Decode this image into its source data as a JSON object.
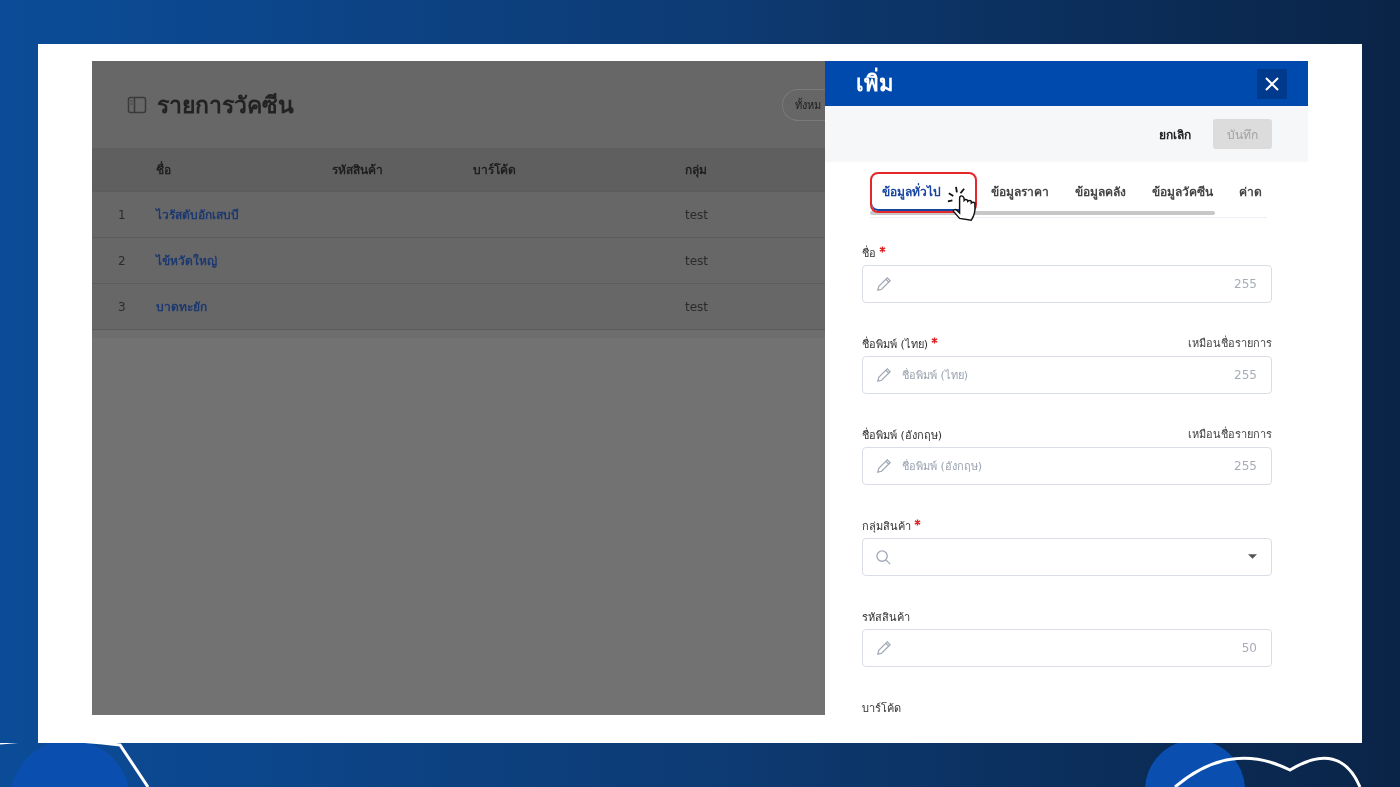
{
  "list_page": {
    "title": "รายการวัคซีน",
    "filter_button": "ทั้งหม"
  },
  "table": {
    "columns": [
      "ชื่อ",
      "รหัสสินค้า",
      "บาร์โค้ด",
      "กลุ่ม"
    ],
    "rows": [
      {
        "number": "1",
        "name": "ไวรัสตับอักเสบบี",
        "group": "test"
      },
      {
        "number": "2",
        "name": "ไข้หวัดใหญ่",
        "group": "test"
      },
      {
        "number": "3",
        "name": "บาดทะยัก",
        "group": "test"
      }
    ]
  },
  "drawer": {
    "title": "เพิ่ม",
    "cancel": "ยกเลิก",
    "save": {
      "label": "บันทึก",
      "disabled": true
    },
    "tabs": [
      {
        "label": "ข้อมูลทั่วไป",
        "selected": true,
        "highlighted": true
      },
      {
        "label": "ข้อมูลราคา",
        "selected": false,
        "highlighted": false
      },
      {
        "label": "ข้อมูลคลัง",
        "selected": false,
        "highlighted": false
      },
      {
        "label": "ข้อมูลวัคซีน",
        "selected": false,
        "highlighted": false
      },
      {
        "label": "ค่าด",
        "selected": false,
        "highlighted": false
      }
    ],
    "fields": [
      {
        "kind": "text",
        "label": "ชื่อ",
        "required": true,
        "counter": "255"
      },
      {
        "kind": "text",
        "label": "ชื่อพิมพ์ (ไทย)",
        "required": true,
        "hint": "เหมือนชื่อรายการ",
        "placeholder": "ชื่อพิมพ์ (ไทย)",
        "counter": "255"
      },
      {
        "kind": "text",
        "label": "ชื่อพิมพ์ (อังกฤษ)",
        "required": false,
        "hint": "เหมือนชื่อรายการ",
        "placeholder": "ชื่อพิมพ์ (อังกฤษ)",
        "counter": "255"
      },
      {
        "kind": "select",
        "label": "กลุ่มสินค้า",
        "required": true
      },
      {
        "kind": "text",
        "label": "รหัสสินค้า",
        "required": false,
        "counter": "50"
      },
      {
        "kind": "cut",
        "label": "บาร์โค้ด",
        "required": false
      }
    ]
  }
}
